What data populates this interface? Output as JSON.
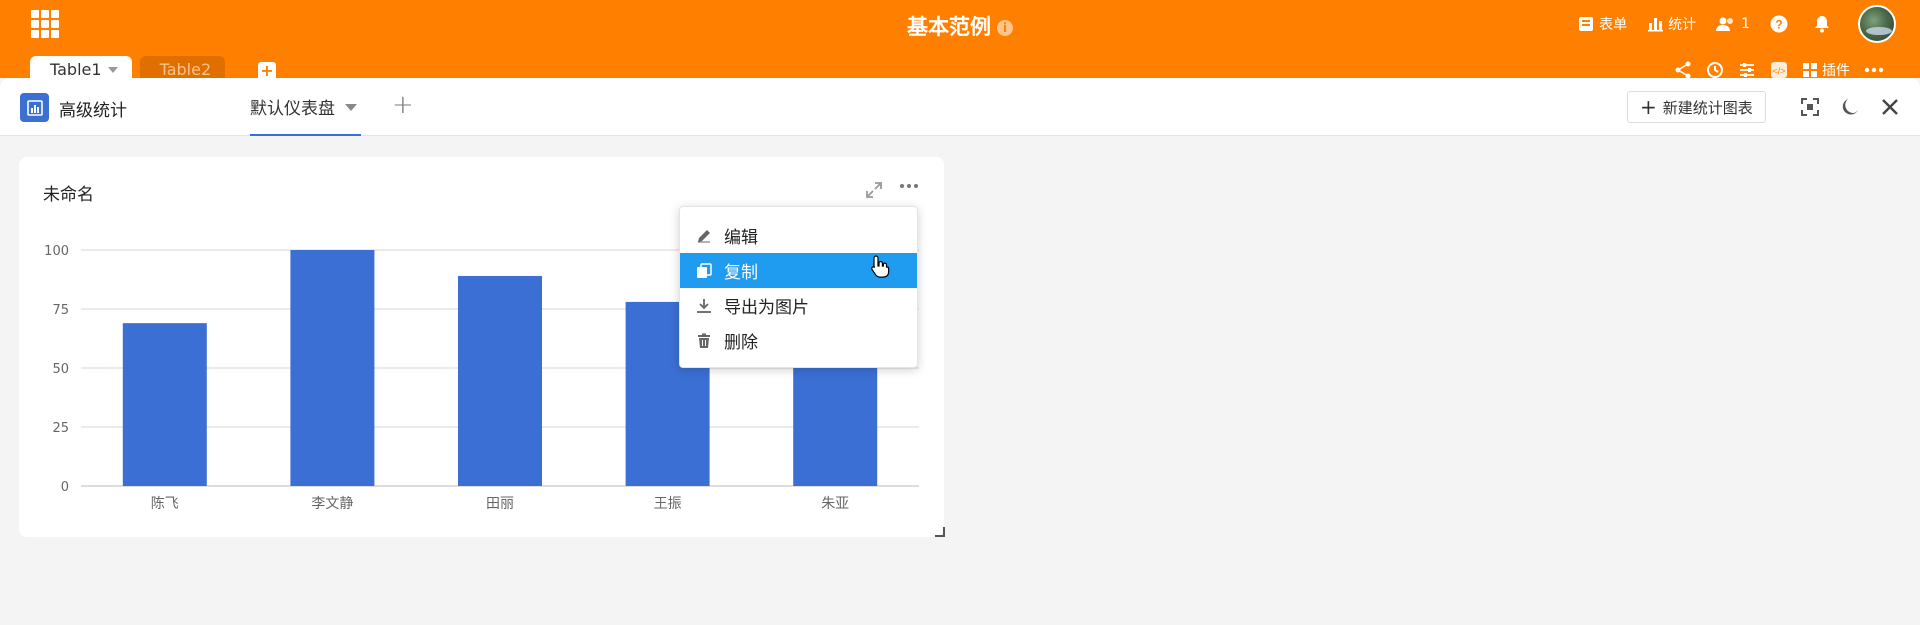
{
  "app": {
    "title": "基本范例",
    "info_badge": "i"
  },
  "top_actions": {
    "form_label": "表单",
    "stats_label": "统计",
    "collaborators_count": "1"
  },
  "table_tabs": [
    {
      "label": "Table1"
    },
    {
      "label": "Table2"
    }
  ],
  "toolbar": {
    "plugins_label": "插件"
  },
  "panel": {
    "title": "高级统计",
    "dashboard_tab": "默认仪表盘",
    "new_chart_label": "新建统计图表"
  },
  "card": {
    "title": "未命名"
  },
  "menu": {
    "items": [
      {
        "label": "编辑",
        "icon": "pencil-icon"
      },
      {
        "label": "复制",
        "icon": "copy-icon"
      },
      {
        "label": "导出为图片",
        "icon": "download-icon"
      },
      {
        "label": "删除",
        "icon": "trash-icon"
      }
    ],
    "hovered_index": 1
  },
  "colors": {
    "brand": "#ff8000",
    "bar": "#3b6fd4",
    "menu_hover": "#1f9bf0"
  },
  "chart_data": {
    "type": "bar",
    "categories": [
      "陈飞",
      "李文静",
      "田丽",
      "王振",
      "朱亚"
    ],
    "values": [
      69,
      100,
      89,
      78,
      88
    ],
    "yticks": [
      "100",
      "75",
      "50",
      "25",
      "0"
    ],
    "ylim": [
      0,
      100
    ],
    "grid": true
  }
}
